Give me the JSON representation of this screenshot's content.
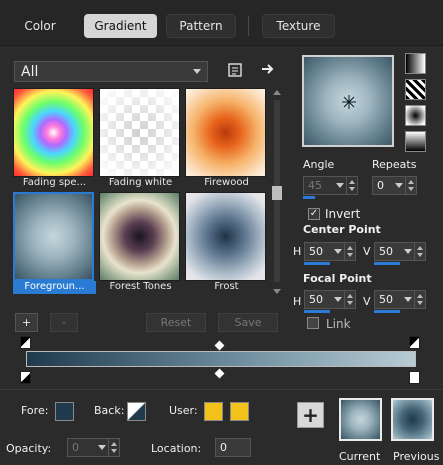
{
  "tabs": {
    "color": "Color",
    "gradient": "Gradient",
    "pattern": "Pattern",
    "texture": "Texture"
  },
  "library": {
    "category": "All",
    "items": [
      {
        "label": "Fading spe..."
      },
      {
        "label": "Fading white"
      },
      {
        "label": "Firewood"
      },
      {
        "label": "Foregroun..."
      },
      {
        "label": "Forest Tones"
      },
      {
        "label": "Frost"
      }
    ],
    "buttons": {
      "add": "+",
      "remove": "-",
      "reset": "Reset",
      "save": "Save"
    }
  },
  "controls": {
    "angle_label": "Angle",
    "angle_value": "45",
    "repeats_label": "Repeats",
    "repeats_value": "0",
    "invert_label": "Invert",
    "invert_checked": true,
    "center_point_label": "Center Point",
    "center_h_label": "H",
    "center_h": "50",
    "center_v_label": "V",
    "center_v": "50",
    "focal_point_label": "Focal Point",
    "focal_h_label": "H",
    "focal_h": "50",
    "focal_v_label": "V",
    "focal_v": "50",
    "link_label": "Link"
  },
  "bottom": {
    "fore_label": "Fore:",
    "back_label": "Back:",
    "user_label": "User:",
    "opacity_label": "Opacity:",
    "opacity_value": "0",
    "location_label": "Location:",
    "location_value": "0",
    "add_label": "+",
    "current_label": "Current",
    "previous_label": "Previous"
  },
  "colors": {
    "fore": "#1f3a4c",
    "user_1": "#f2c21b",
    "user_2": "#f2c21b",
    "accent": "#2a7bd4"
  }
}
